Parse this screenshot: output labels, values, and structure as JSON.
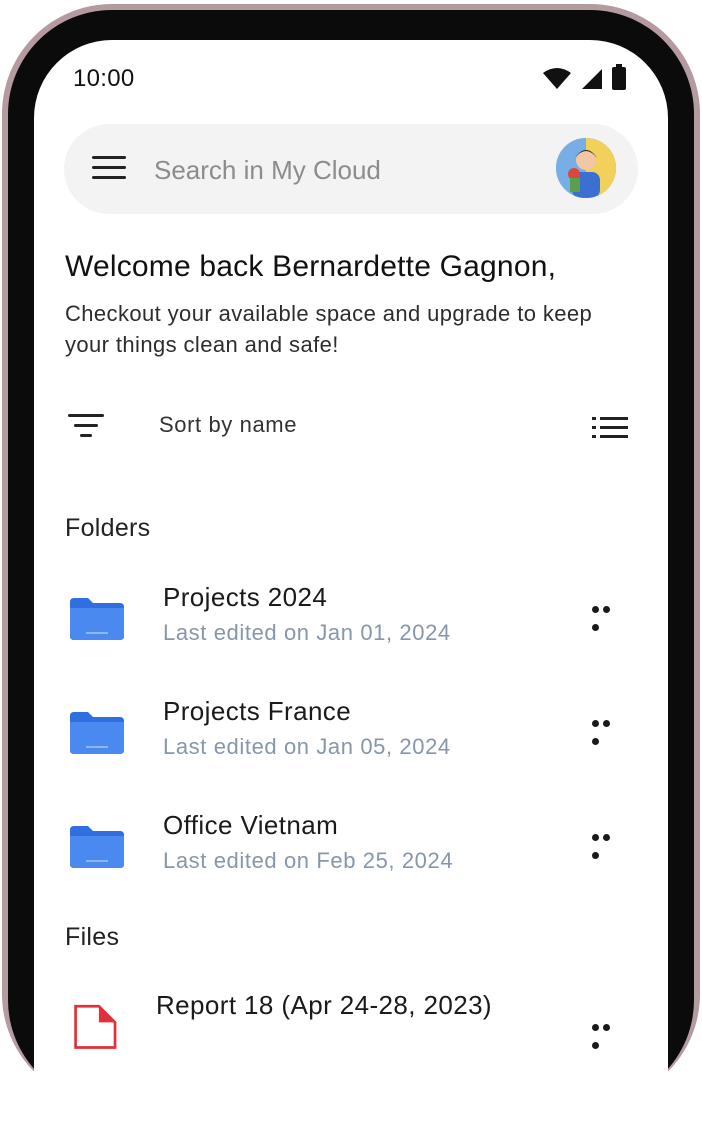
{
  "status_bar": {
    "time": "10:00"
  },
  "search": {
    "placeholder": "Search in My Cloud"
  },
  "greeting": {
    "title": "Welcome back Bernardette Gagnon,",
    "subtitle": "Checkout your available space and upgrade to keep your things clean and safe!"
  },
  "sort": {
    "label": "Sort by name"
  },
  "sections": {
    "folders": "Folders",
    "files": "Files"
  },
  "folders": [
    {
      "name": "Projects 2024",
      "meta": "Last edited on Jan 01, 2024"
    },
    {
      "name": "Projects France",
      "meta": "Last edited on Jan 05, 2024"
    },
    {
      "name": "Office Vietnam",
      "meta": "Last edited on Feb 25, 2024"
    }
  ],
  "files": [
    {
      "name": "Report 18 (Apr 24-28, 2023)"
    }
  ],
  "colors": {
    "folder": "#3b7ce8",
    "meta_text": "#8696ab",
    "search_bg": "#f3f3f3"
  }
}
